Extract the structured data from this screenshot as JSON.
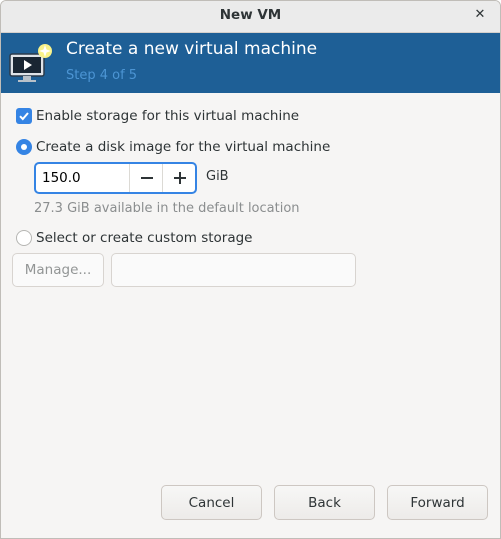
{
  "window": {
    "title": "New VM",
    "close_glyph": "✕"
  },
  "header": {
    "title": "Create a new virtual machine",
    "step": "Step 4 of 5",
    "icon": "vm-monitor-icon",
    "colors": {
      "banner": "#1e5f96",
      "step_text": "#4c95d4"
    }
  },
  "storage": {
    "enable_label": "Enable storage for this virtual machine",
    "enable_checked": true,
    "create_disk_label": "Create a disk image for the virtual machine",
    "create_disk_selected": true,
    "size_value": "150.0",
    "size_unit": "GiB",
    "available_hint": "27.3 GiB available in the default location",
    "custom_label": "Select or create custom storage",
    "custom_selected": false,
    "manage_label": "Manage...",
    "custom_path_value": ""
  },
  "footer": {
    "cancel_label": "Cancel",
    "back_label": "Back",
    "forward_label": "Forward"
  },
  "accent_color": "#3584e4"
}
